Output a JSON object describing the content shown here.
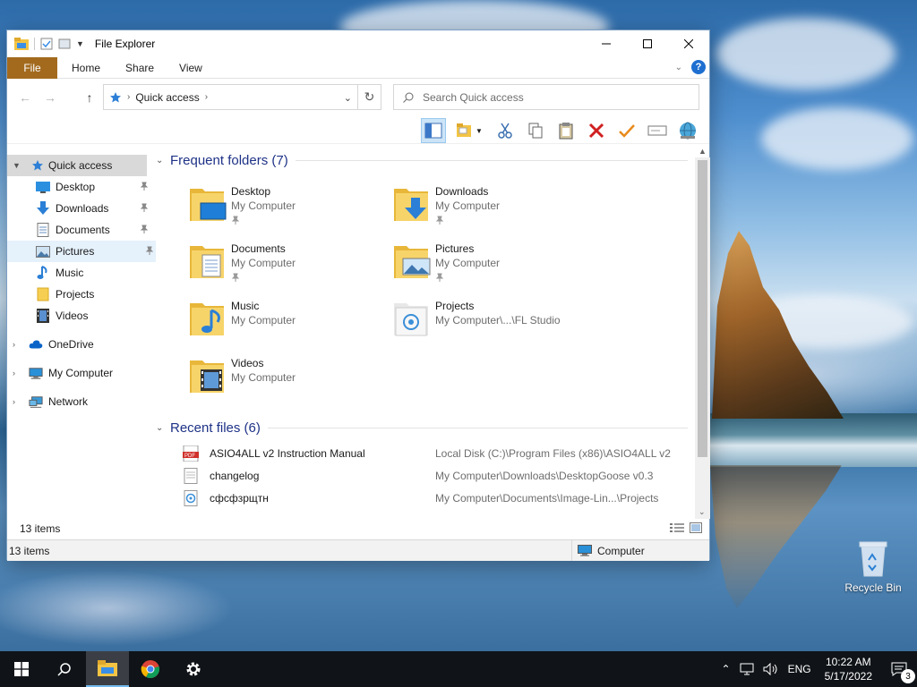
{
  "window": {
    "title": "File Explorer",
    "ribbon_tabs": [
      "File",
      "Home",
      "Share",
      "View"
    ],
    "help_label": "?"
  },
  "address_bar": {
    "location": "Quick access",
    "search_placeholder": "Search Quick access"
  },
  "nav": {
    "quick_access": "Quick access",
    "pinned": [
      {
        "label": "Desktop",
        "icon": "desktop-icon",
        "pinned": true
      },
      {
        "label": "Downloads",
        "icon": "downloads-icon",
        "pinned": true
      },
      {
        "label": "Documents",
        "icon": "documents-icon",
        "pinned": true
      },
      {
        "label": "Pictures",
        "icon": "pictures-icon",
        "pinned": true
      },
      {
        "label": "Music",
        "icon": "music-icon",
        "pinned": false
      },
      {
        "label": "Projects",
        "icon": "folder-icon",
        "pinned": false
      },
      {
        "label": "Videos",
        "icon": "videos-icon",
        "pinned": false
      }
    ],
    "onedrive": "OneDrive",
    "my_computer": "My Computer",
    "network": "Network"
  },
  "frequent": {
    "header": "Frequent folders (7)",
    "folders": [
      {
        "name": "Desktop",
        "location": "My Computer",
        "pinned": true
      },
      {
        "name": "Downloads",
        "location": "My Computer",
        "pinned": true
      },
      {
        "name": "Documents",
        "location": "My Computer",
        "pinned": true
      },
      {
        "name": "Pictures",
        "location": "My Computer",
        "pinned": true
      },
      {
        "name": "Music",
        "location": "My Computer",
        "pinned": false
      },
      {
        "name": "Projects",
        "location": "My Computer\\...\\FL Studio",
        "pinned": false
      },
      {
        "name": "Videos",
        "location": "My Computer",
        "pinned": false
      }
    ]
  },
  "recent": {
    "header": "Recent files (6)",
    "files": [
      {
        "name": "ASIO4ALL v2 Instruction Manual",
        "location": "Local Disk (C:)\\Program Files (x86)\\ASIO4ALL v2",
        "icon": "pdf-icon"
      },
      {
        "name": "changelog",
        "location": "My Computer\\Downloads\\DesktopGoose v0.3",
        "icon": "text-file-icon"
      },
      {
        "name": "сфсфзрщтн",
        "location": "My Computer\\Documents\\Image-Lin...\\Projects",
        "icon": "fl-studio-file-icon"
      }
    ]
  },
  "status": {
    "items_inner": "13 items",
    "items": "13 items",
    "computer": "Computer"
  },
  "desktop": {
    "recycle_bin": "Recycle Bin"
  },
  "taskbar": {
    "language": "ENG",
    "time": "10:22 AM",
    "date": "5/17/2022",
    "notification_count": "3"
  },
  "colors": {
    "file_tab": "#a36a1e",
    "group_header": "#1e3287",
    "selection": "#cce4f7",
    "taskbar": "#101418"
  }
}
